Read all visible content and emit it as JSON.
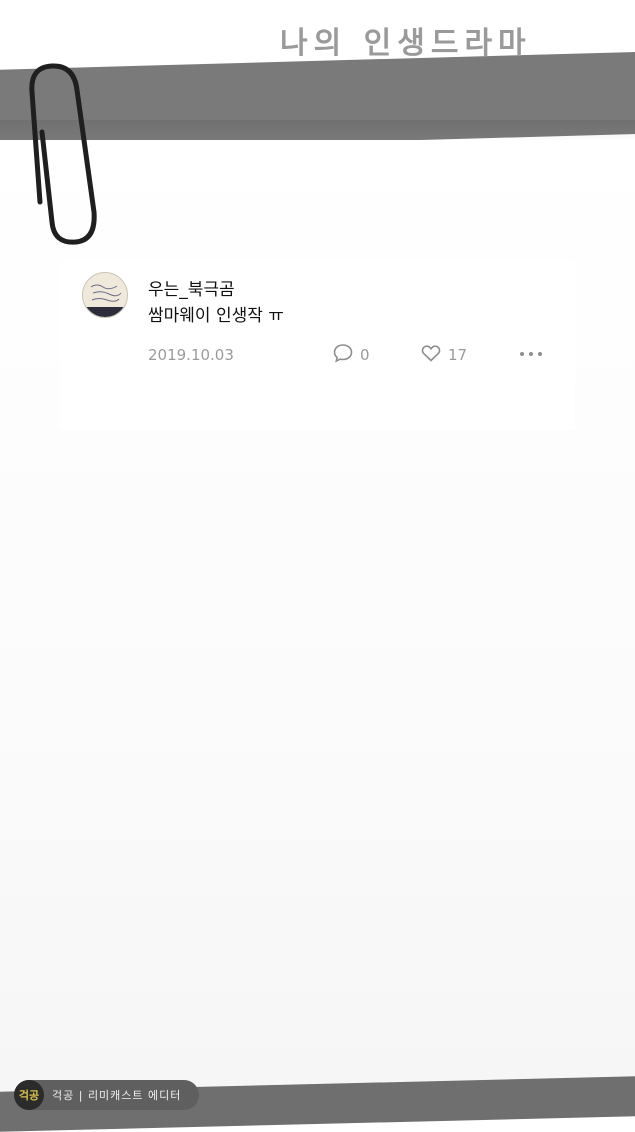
{
  "header": {
    "title": "나의 인생드라마"
  },
  "comment": {
    "author": "우는_북극곰",
    "text": "쌈마웨이 인생작 ㅠ",
    "date": "2019.10.03",
    "comment_count": "0",
    "like_count": "17"
  },
  "badge": {
    "logo_text": "걱공",
    "label": "걱공 | 리미캐스트 에디터"
  },
  "icons": {
    "comment": "speech-bubble-icon",
    "like": "heart-icon",
    "more": "ellipsis-icon",
    "clip": "paperclip-icon"
  },
  "colors": {
    "band": "#7a7a7a",
    "meta": "#9b9b9b",
    "badge_bg": "#5f5f5f",
    "badge_logo": "#d9c24a"
  }
}
